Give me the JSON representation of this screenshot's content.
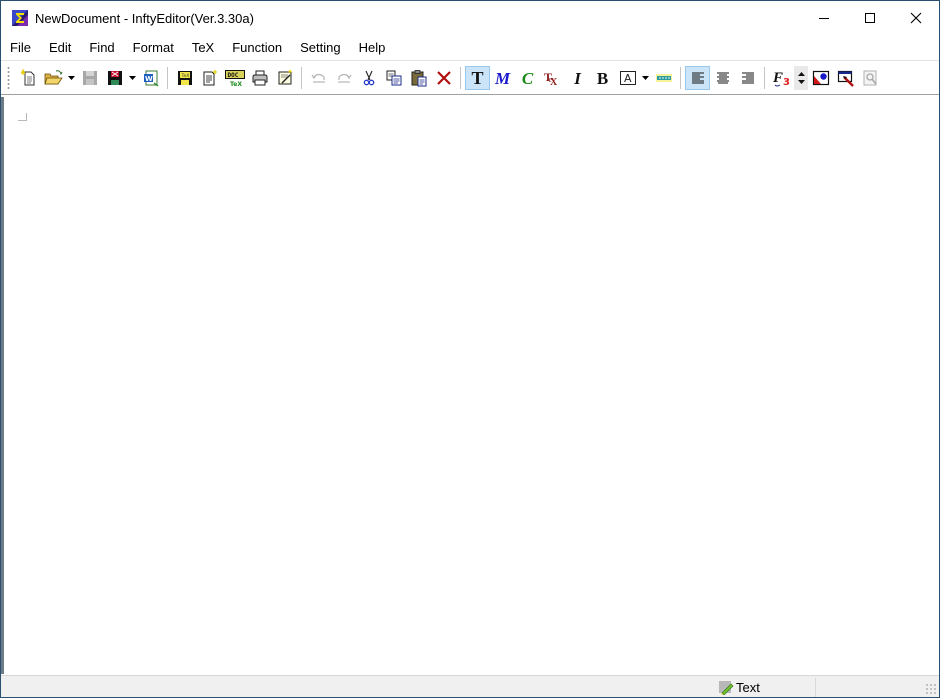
{
  "window": {
    "title": "NewDocument - InftyEditor(Ver.3.30a)",
    "controls": {
      "minimize": "minimize-icon",
      "maximize": "maximize-icon",
      "close": "close-icon"
    }
  },
  "menubar": {
    "items": [
      {
        "label": "File"
      },
      {
        "label": "Edit"
      },
      {
        "label": "Find"
      },
      {
        "label": "Format"
      },
      {
        "label": "TeX"
      },
      {
        "label": "Function"
      },
      {
        "label": "Setting"
      },
      {
        "label": "Help"
      }
    ]
  },
  "toolbar": {
    "buttons": [
      {
        "name": "new-document",
        "icon": "new-document-icon"
      },
      {
        "name": "open",
        "icon": "open-folder-icon",
        "dropdown": true
      },
      {
        "name": "save",
        "icon": "save-icon",
        "disabled": true
      },
      {
        "name": "save-as",
        "icon": "save-as-icon",
        "dropdown": true
      },
      {
        "name": "export-word",
        "icon": "word-export-icon"
      },
      {
        "name": "save-tex",
        "icon": "save-tex-icon"
      },
      {
        "name": "new-page",
        "icon": "new-page-icon"
      },
      {
        "name": "tex-compile",
        "icon": "tex-compile-icon",
        "sublabel": "TeX"
      },
      {
        "name": "print",
        "icon": "print-icon"
      },
      {
        "name": "edit-properties",
        "icon": "edit-properties-icon"
      },
      {
        "name": "undo",
        "icon": "undo-icon",
        "disabled": true
      },
      {
        "name": "redo",
        "icon": "redo-icon",
        "disabled": true
      },
      {
        "name": "cut",
        "icon": "scissors-icon"
      },
      {
        "name": "copy",
        "icon": "copy-icon"
      },
      {
        "name": "paste",
        "icon": "paste-icon"
      },
      {
        "name": "delete",
        "icon": "delete-x-icon"
      },
      {
        "name": "text-mode",
        "glyph": "T",
        "pressed": true
      },
      {
        "name": "math-mode",
        "glyph": "M"
      },
      {
        "name": "chemistry-mode",
        "glyph": "C"
      },
      {
        "name": "tex-mode",
        "glyph": "TeX"
      },
      {
        "name": "italic",
        "glyph": "I"
      },
      {
        "name": "bold",
        "glyph": "B"
      },
      {
        "name": "font-style",
        "glyph": "A",
        "dropdown": true
      },
      {
        "name": "highlight",
        "icon": "highlight-icon"
      },
      {
        "name": "align-left",
        "icon": "align-left-icon",
        "pressed": true
      },
      {
        "name": "align-center",
        "icon": "align-center-icon"
      },
      {
        "name": "align-right",
        "icon": "align-right-icon"
      },
      {
        "name": "font-size",
        "glyph": "F",
        "sub": "3"
      },
      {
        "name": "font-size-spinner",
        "icon": "spinner-icon"
      },
      {
        "name": "insert-image",
        "icon": "image-icon"
      },
      {
        "name": "select-region",
        "icon": "select-region-icon"
      },
      {
        "name": "zoom-search",
        "icon": "magnifier-icon",
        "disabled": true
      }
    ]
  },
  "colors": {
    "accent_pressed": "#cce4f7",
    "math_blue": "#1a1acc",
    "chem_green": "#178a17",
    "tex_red": "#8b1a1a",
    "font_size_red": "#e02020"
  },
  "statusbar": {
    "mode_label": "Text",
    "mode_icon": "pencil-icon"
  }
}
